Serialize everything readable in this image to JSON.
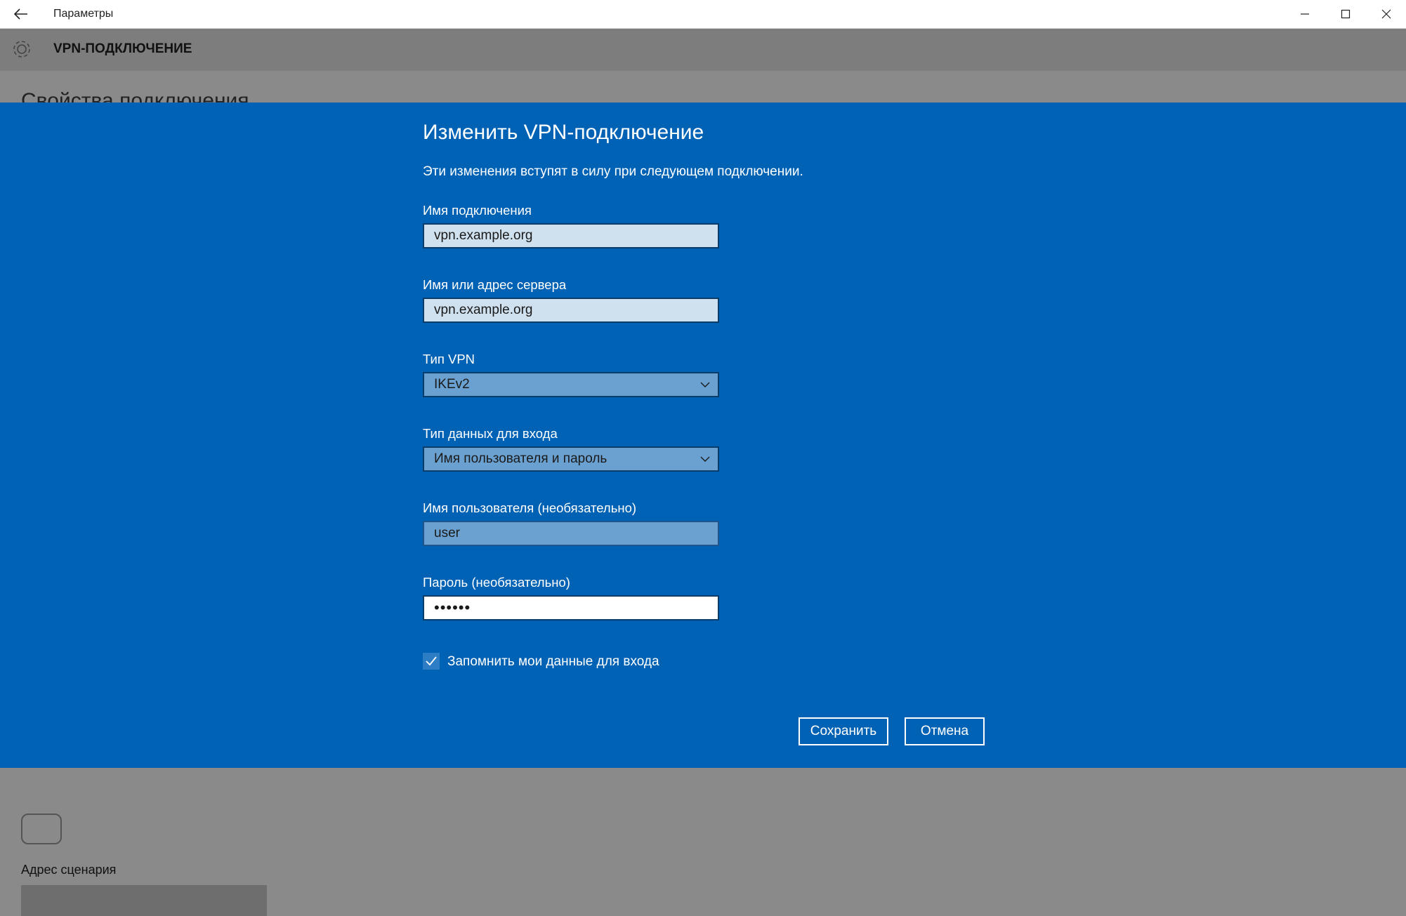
{
  "window": {
    "title": "Параметры",
    "icons": {
      "back": "back-arrow-icon",
      "minimize": "minimize-icon",
      "maximize": "maximize-icon",
      "close": "close-icon"
    }
  },
  "background": {
    "section_title": "VPN-ПОДКЛЮЧЕНИЕ",
    "heading": "Свойства подключения",
    "script_address_label": "Адрес сценария"
  },
  "dialog": {
    "title": "Изменить VPN-подключение",
    "subtitle": "Эти изменения вступят в силу при следующем подключении.",
    "fields": {
      "connection_name": {
        "label": "Имя подключения",
        "value": "vpn.example.org"
      },
      "server": {
        "label": "Имя или адрес сервера",
        "value": "vpn.example.org"
      },
      "vpn_type": {
        "label": "Тип VPN",
        "value": "IKEv2"
      },
      "signin_type": {
        "label": "Тип данных для входа",
        "value": "Имя пользователя и пароль"
      },
      "username": {
        "label": "Имя пользователя (необязательно)",
        "value": "user"
      },
      "password": {
        "label": "Пароль (необязательно)",
        "value": "••••••"
      }
    },
    "remember": {
      "label": "Запомнить мои данные для входа",
      "checked": true
    },
    "buttons": {
      "save": "Сохранить",
      "cancel": "Отмена"
    }
  },
  "colors": {
    "dialog_bg": "#0062b4",
    "overlay_bg": "#8a8a8a",
    "text_field_bg": "#cfe0ef",
    "select_bg": "#6aa1d1"
  }
}
